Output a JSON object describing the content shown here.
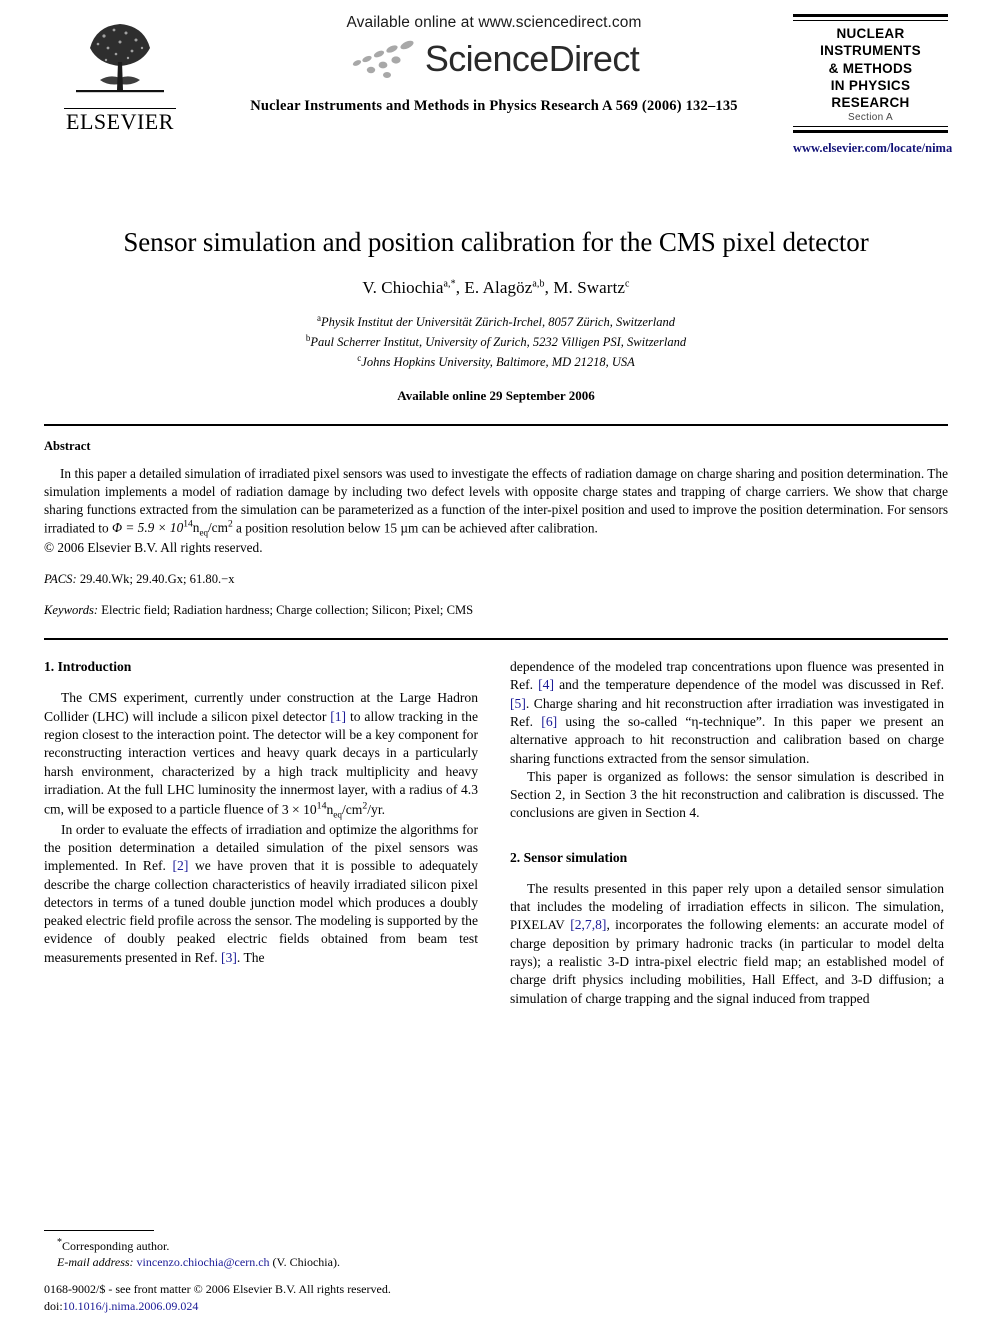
{
  "header": {
    "publisher_name": "ELSEVIER",
    "publisher_logo_icon": "elsevier-tree-icon",
    "available_online": "Available online at www.sciencedirect.com",
    "sciencedirect_wordmark": "ScienceDirect",
    "sciencedirect_swoosh_icon": "sciencedirect-swoosh-icon",
    "journal_citation": "Nuclear Instruments and Methods in Physics Research A 569 (2006) 132–135",
    "journal_box": {
      "lines": [
        "NUCLEAR",
        "INSTRUMENTS",
        "& METHODS",
        "IN PHYSICS",
        "RESEARCH"
      ],
      "section": "Section A"
    },
    "journal_url": "www.elsevier.com/locate/nima"
  },
  "article": {
    "title": "Sensor simulation and position calibration for the CMS pixel detector",
    "authors_plain": "V. Chiochia a,*, E. Alagöz a,b, M. Swartz c",
    "authors": [
      {
        "name": "V. Chiochia",
        "marks": "a,*"
      },
      {
        "name": "E. Alagöz",
        "marks": "a,b"
      },
      {
        "name": "M. Swartz",
        "marks": "c"
      }
    ],
    "affiliations": [
      {
        "mark": "a",
        "text": "Physik Institut der Universität Zürich-Irchel, 8057 Zürich, Switzerland"
      },
      {
        "mark": "b",
        "text": "Paul Scherrer Institut, University of Zurich, 5232 Villigen PSI, Switzerland"
      },
      {
        "mark": "c",
        "text": "Johns Hopkins University, Baltimore, MD 21218, USA"
      }
    ],
    "available_online_date": "Available online 29 September 2006"
  },
  "abstract": {
    "heading": "Abstract",
    "part1": "In this paper a detailed simulation of irradiated pixel sensors was used to investigate the effects of radiation damage on charge sharing and position determination. The simulation implements a model of radiation damage by including two defect levels with opposite charge states and trapping of charge carriers. We show that charge sharing functions extracted from the simulation can be parameterized as a function of the inter-pixel position and used to improve the position determination. For sensors irradiated to ",
    "formula_phi": "Φ = 5.9 × 10",
    "formula_exp": "14",
    "formula_unit_n": "n",
    "formula_unit_sub": "eq",
    "formula_unit_cm": "/cm",
    "formula_cm_exp": "2",
    "part2": " a position resolution below 15 µm can be achieved after calibration.",
    "copyright": "© 2006 Elsevier B.V. All rights reserved.",
    "pacs_label": "PACS:",
    "pacs_value": "29.40.Wk; 29.40.Gx; 61.80.−x",
    "keywords_label": "Keywords:",
    "keywords_value": "Electric field; Radiation hardness; Charge collection; Silicon; Pixel; CMS"
  },
  "body": {
    "left_column": {
      "section1_heading": "1. Introduction",
      "para1_a": "The CMS experiment, currently under construction at the Large Hadron Collider (LHC) will include a silicon pixel detector ",
      "para1_cite1": "[1]",
      "para1_b": " to allow tracking in the region closest to the interaction point. The detector will be a key component for reconstructing interaction vertices and heavy quark decays in a particularly harsh environment, characterized by a high track multiplicity and heavy irradiation. At the full LHC luminosity the innermost layer, with a radius of 4.3 cm, will be exposed to a particle fluence of ",
      "para1_fluence": "3 × 10",
      "para1_fluence_exp": "14",
      "para1_fluence_n": "n",
      "para1_fluence_sub": "eq",
      "para1_fluence_tail": "/cm",
      "para1_fluence_cm_exp": "2",
      "para1_fluence_end": "/yr.",
      "para2_a": "In order to evaluate the effects of irradiation and optimize the algorithms for the position determination a detailed simulation of the pixel sensors was implemented. In Ref. ",
      "para2_cite2": "[2]",
      "para2_b": " we have proven that it is possible to adequately describe the charge collection characteristics of heavily irradiated silicon pixel detectors in terms of a tuned double junction model which produces a doubly peaked electric field profile across the sensor. The modeling is supported by the evidence of doubly peaked electric fields obtained from beam test measurements presented in Ref. ",
      "para2_cite3": "[3]",
      "para2_c": ". The"
    },
    "right_column": {
      "para_cont_a": "dependence of the modeled trap concentrations upon fluence was presented in Ref. ",
      "para_cont_cite4": "[4]",
      "para_cont_b": " and the temperature dependence of the model was discussed in Ref. ",
      "para_cont_cite5": "[5]",
      "para_cont_c": ". Charge sharing and hit reconstruction after irradiation was investigated in Ref. ",
      "para_cont_cite6": "[6]",
      "para_cont_d": " using the so-called “η-technique”. In this paper we present an alternative approach to hit reconstruction and calibration based on charge sharing functions extracted from the sensor simulation.",
      "para_org": "This paper is organized as follows: the sensor simulation is described in Section 2, in Section 3 the hit reconstruction and calibration is discussed. The conclusions are given in Section 4.",
      "section2_heading": "2. Sensor simulation",
      "para_sim_a": "The results presented in this paper rely upon a detailed sensor simulation that includes the modeling of irradiation effects in silicon. The simulation, ",
      "para_sim_pixelav": "PIXELAV",
      "para_sim_space": " ",
      "para_sim_cite": "[2,7,8]",
      "para_sim_b": ", incorporates the following elements: an accurate model of charge deposition by primary hadronic tracks (in particular to model delta rays); a realistic 3-D intra-pixel electric field map; an established model of charge drift physics including mobilities, Hall Effect, and 3-D diffusion; a simulation of charge trapping and the signal induced from trapped"
    }
  },
  "footnotes": {
    "corresponding": "Corresponding author.",
    "corresponding_mark": "*",
    "email_label": "E-mail address:",
    "email_value": "vincenzo.chiochia@cern.ch",
    "email_owner": "(V. Chiochia)."
  },
  "footer": {
    "legal": "0168-9002/$ - see front matter © 2006 Elsevier B.V. All rights reserved.",
    "doi_label": "doi:",
    "doi_value": "10.1016/j.nima.2006.09.024"
  },
  "colors": {
    "link": "#1a1a96",
    "text": "#000000",
    "journal_url": "#141478"
  }
}
